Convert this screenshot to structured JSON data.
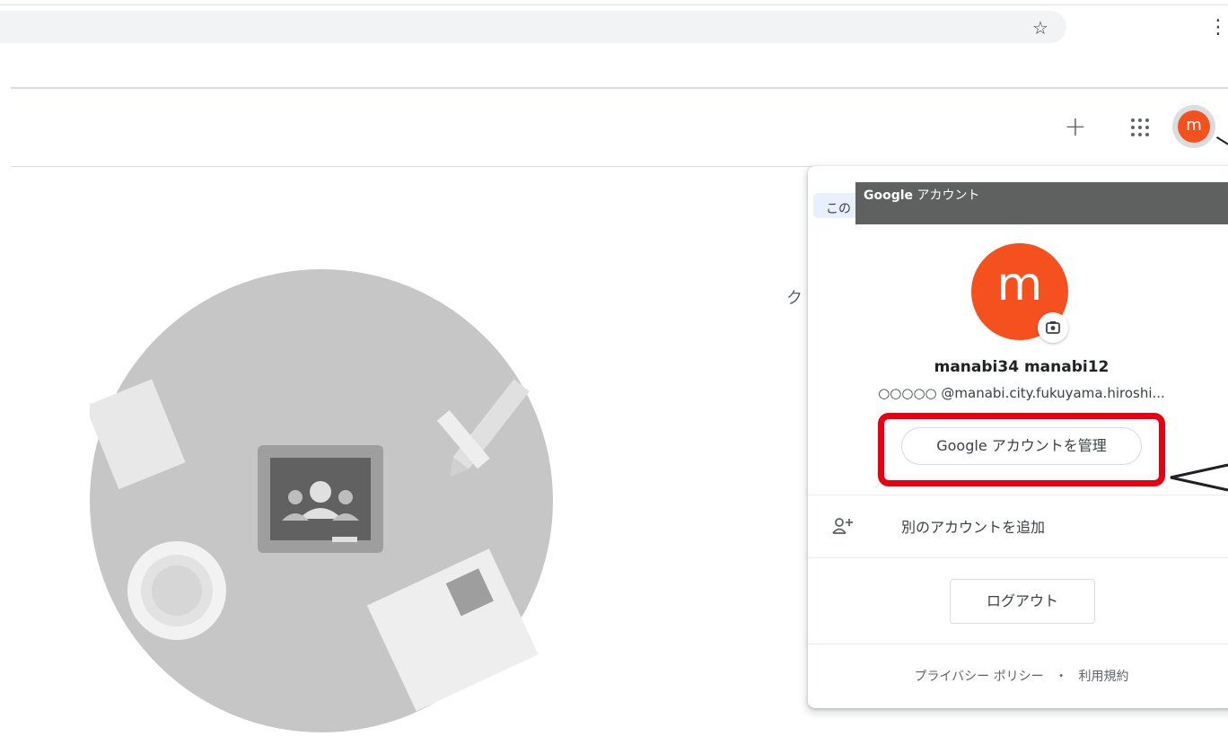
{
  "browser": {
    "star_icon": "star-outline-icon",
    "menu_icon": "kebab-menu-icon"
  },
  "header": {
    "create_icon": "plus-icon",
    "apps_icon": "apps-grid-icon",
    "avatar_letter": "m",
    "avatar_color": "#f4511e"
  },
  "page": {
    "partial_text": "ク"
  },
  "tooltip": {
    "brand": "Google",
    "label": " アカウント"
  },
  "account_popup": {
    "notice_partial": "この",
    "avatar_letter": "m",
    "camera_icon": "camera-icon",
    "name": "manabi34 manabi12",
    "email": "○○○○○ @manabi.city.fukuyama.hiroshi...",
    "manage_button": "Google アカウントを管理",
    "add_account_icon": "person-add-icon",
    "add_account_label": "別のアカウントを追加",
    "logout_button": "ログアウト",
    "privacy_link": "プライバシー ポリシー",
    "footer_separator": "・",
    "terms_link": "利用規約"
  },
  "colors": {
    "accent_red": "#e60012",
    "avatar_orange": "#f4511e",
    "tooltip_bg": "#5f6161"
  }
}
